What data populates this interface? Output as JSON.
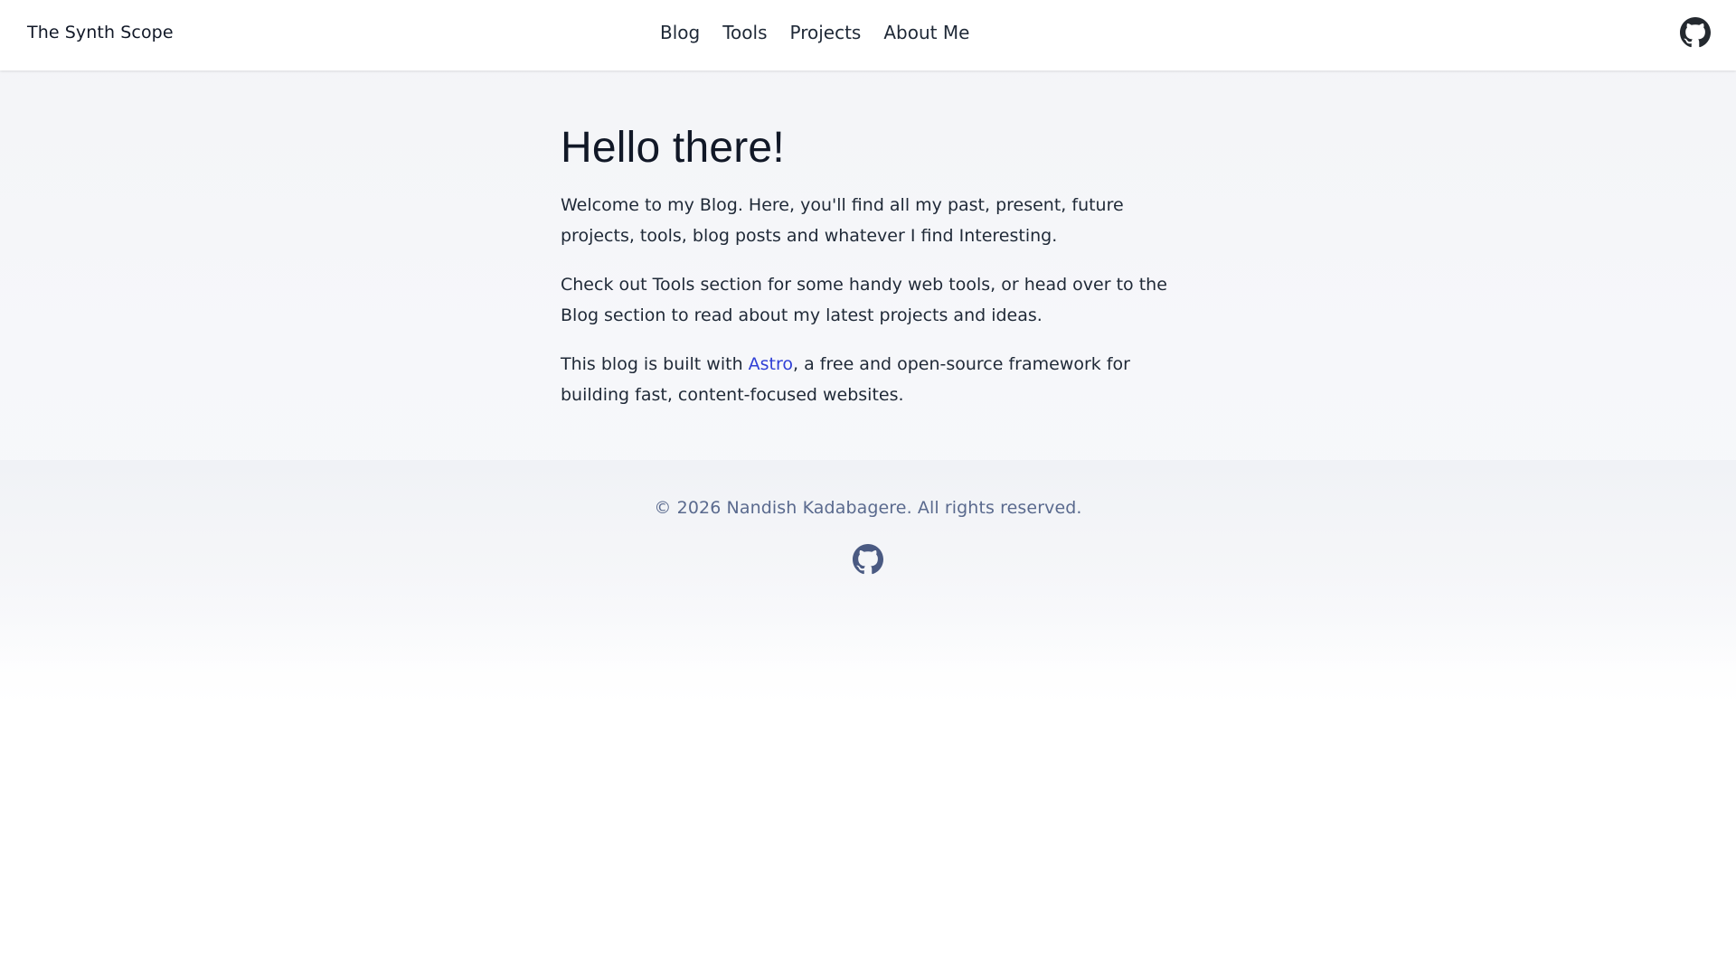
{
  "header": {
    "brand": "The Synth Scope",
    "nav": [
      {
        "label": "Blog"
      },
      {
        "label": "Tools"
      },
      {
        "label": "Projects"
      },
      {
        "label": "About Me"
      }
    ],
    "github_icon": "github-icon"
  },
  "main": {
    "title": "Hello there!",
    "paragraphs": [
      "Welcome to my Blog. Here, you'll find all my past, present, future projects, tools, blog posts and whatever I find Interesting.",
      "Check out Tools section for some handy web tools, or head over to the Blog section to read about my latest projects and ideas."
    ],
    "astro_para": {
      "before": "This blog is built with ",
      "link": "Astro",
      "after": ", a free and open-source framework for building fast, content-focused websites."
    }
  },
  "footer": {
    "copyright": "© 2026 Nandish Kadabagere. All rights reserved.",
    "github_icon": "github-icon"
  },
  "colors": {
    "link": "#2f3fd6",
    "footer_text": "#5a6a8e",
    "header_icon": "#24292f",
    "footer_icon": "#4a5a82"
  }
}
